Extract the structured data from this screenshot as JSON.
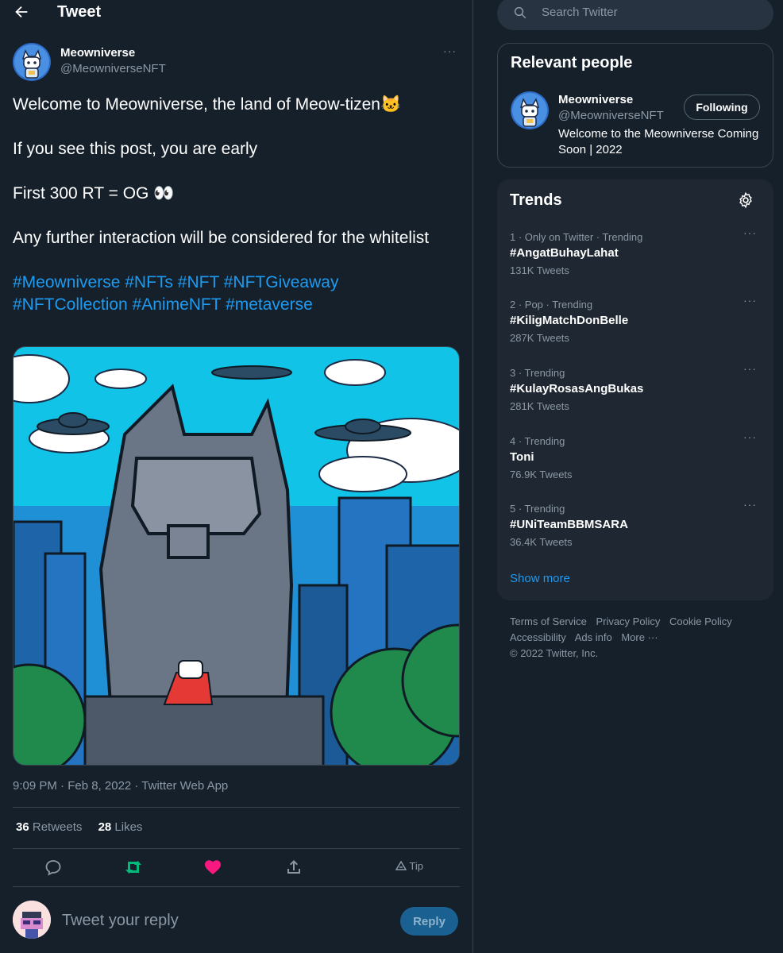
{
  "header": {
    "title": "Tweet",
    "back_icon": "arrow-left-icon"
  },
  "tweet": {
    "author_name": "Meowniverse",
    "author_handle": "@MeowniverseNFT",
    "more": "···",
    "lines": [
      "Welcome to Meowniverse, the land of Meow-tizen🐱",
      "If you see this post, you are early",
      "First 300 RT = OG 👀",
      "Any further interaction will be considered for the whitelist"
    ],
    "hashtags": [
      "#Meowniverse",
      "#NFTs",
      "#NFT",
      "#NFTGiveaway",
      "#NFTCollection",
      "#AnimeNFT",
      "#metaverse"
    ],
    "meta": "9:09 PM · Feb 8, 2022 · Twitter Web App",
    "retweets_count": "36",
    "retweets_label": " Retweets",
    "likes_count": "28",
    "likes_label": " Likes",
    "tip_label": "Tip",
    "liked": true,
    "colors": {
      "like": "#f91880",
      "retweet": "#00ba7c",
      "link": "#1d9bf0"
    }
  },
  "reply": {
    "placeholder": "Tweet your reply",
    "button_label": "Reply"
  },
  "sidebar": {
    "search_placeholder": "Search Twitter",
    "relevant": {
      "title": "Relevant people",
      "name": "Meowniverse",
      "handle": "@MeowniverseNFT",
      "button_label": "Following",
      "bio": "Welcome to the Meowniverse Coming Soon | 2022"
    },
    "trends": {
      "title": "Trends",
      "items": [
        {
          "meta": "1 · Only on Twitter · Trending",
          "name": "#AngatBuhayLahat",
          "count": "131K Tweets"
        },
        {
          "meta": "2 · Pop · Trending",
          "name": "#KiligMatchDonBelle",
          "count": "287K Tweets"
        },
        {
          "meta": "3 · Trending",
          "name": "#KulayRosasAngBukas",
          "count": "281K Tweets"
        },
        {
          "meta": "4 · Trending",
          "name": "Toni",
          "count": "76.9K Tweets"
        },
        {
          "meta": "5 · Trending",
          "name": "#UNiTeamBBMSARA",
          "count": "36.4K Tweets"
        }
      ],
      "show_more": "Show more"
    },
    "footer": {
      "links": [
        "Terms of Service",
        "Privacy Policy",
        "Cookie Policy",
        "Accessibility",
        "Ads info",
        "More ···"
      ],
      "copyright": "© 2022 Twitter, Inc."
    }
  }
}
